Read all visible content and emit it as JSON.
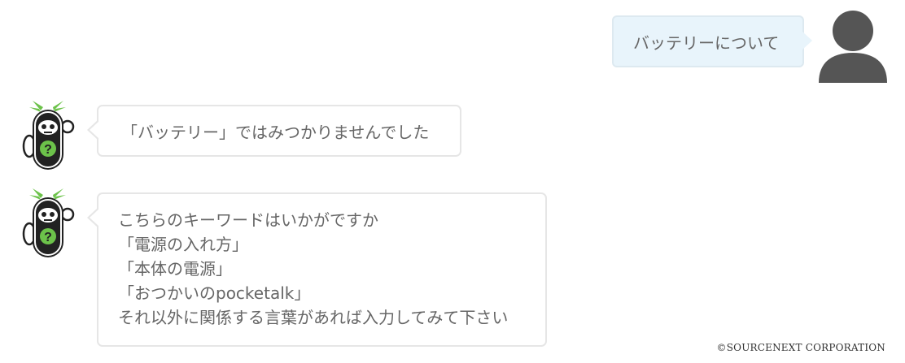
{
  "conversation": {
    "user_message": {
      "text": "バッテリーについて",
      "avatar_icon": "person-icon"
    },
    "bot_message_1": {
      "text": "「バッテリー」ではみつかりませんでした",
      "avatar_icon": "pocketalk-mascot-icon"
    },
    "bot_message_2": {
      "avatar_icon": "pocketalk-mascot-icon",
      "lines": [
        "こちらのキーワードはいかがですか",
        "「電源の入れ方」",
        "「本体の電源」",
        "「おつかいのpocketalk」",
        "それ以外に関係する言葉があれば入力してみて下さい"
      ]
    }
  },
  "footer": {
    "copyright": "©SOURCENEXT CORPORATION"
  },
  "colors": {
    "user_bubble_bg": "#e8f4fb",
    "bot_bubble_border": "#e6e6e6",
    "text": "#666666",
    "mascot_green": "#6cc24a",
    "avatar_gray": "#555555"
  }
}
